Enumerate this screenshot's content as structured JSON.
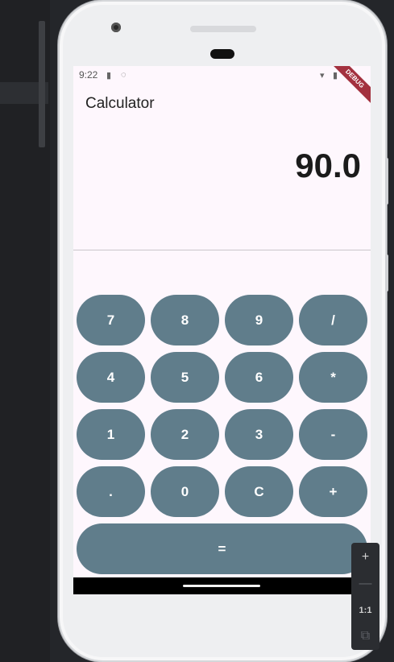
{
  "status_bar": {
    "time": "9:22",
    "icons": [
      "sd-card-icon",
      "wifi-icon",
      "signal-icon",
      "battery-icon"
    ]
  },
  "app": {
    "title": "Calculator",
    "display_value": "90.0",
    "debug_label": "DEBUG"
  },
  "keypad": {
    "keys": [
      [
        "7",
        "8",
        "9",
        "/"
      ],
      [
        "4",
        "5",
        "6",
        "*"
      ],
      [
        "1",
        "2",
        "3",
        "-"
      ],
      [
        ".",
        "0",
        "C",
        "+"
      ]
    ],
    "equals": "="
  },
  "zoom": {
    "zoom_in": "+",
    "zoom_out": "—",
    "actual_size": "1:1",
    "fit": "⧉"
  },
  "colors": {
    "button": "#607d8b",
    "screen_bg": "#fef7fd",
    "debug_ribbon": "#a3313f"
  }
}
